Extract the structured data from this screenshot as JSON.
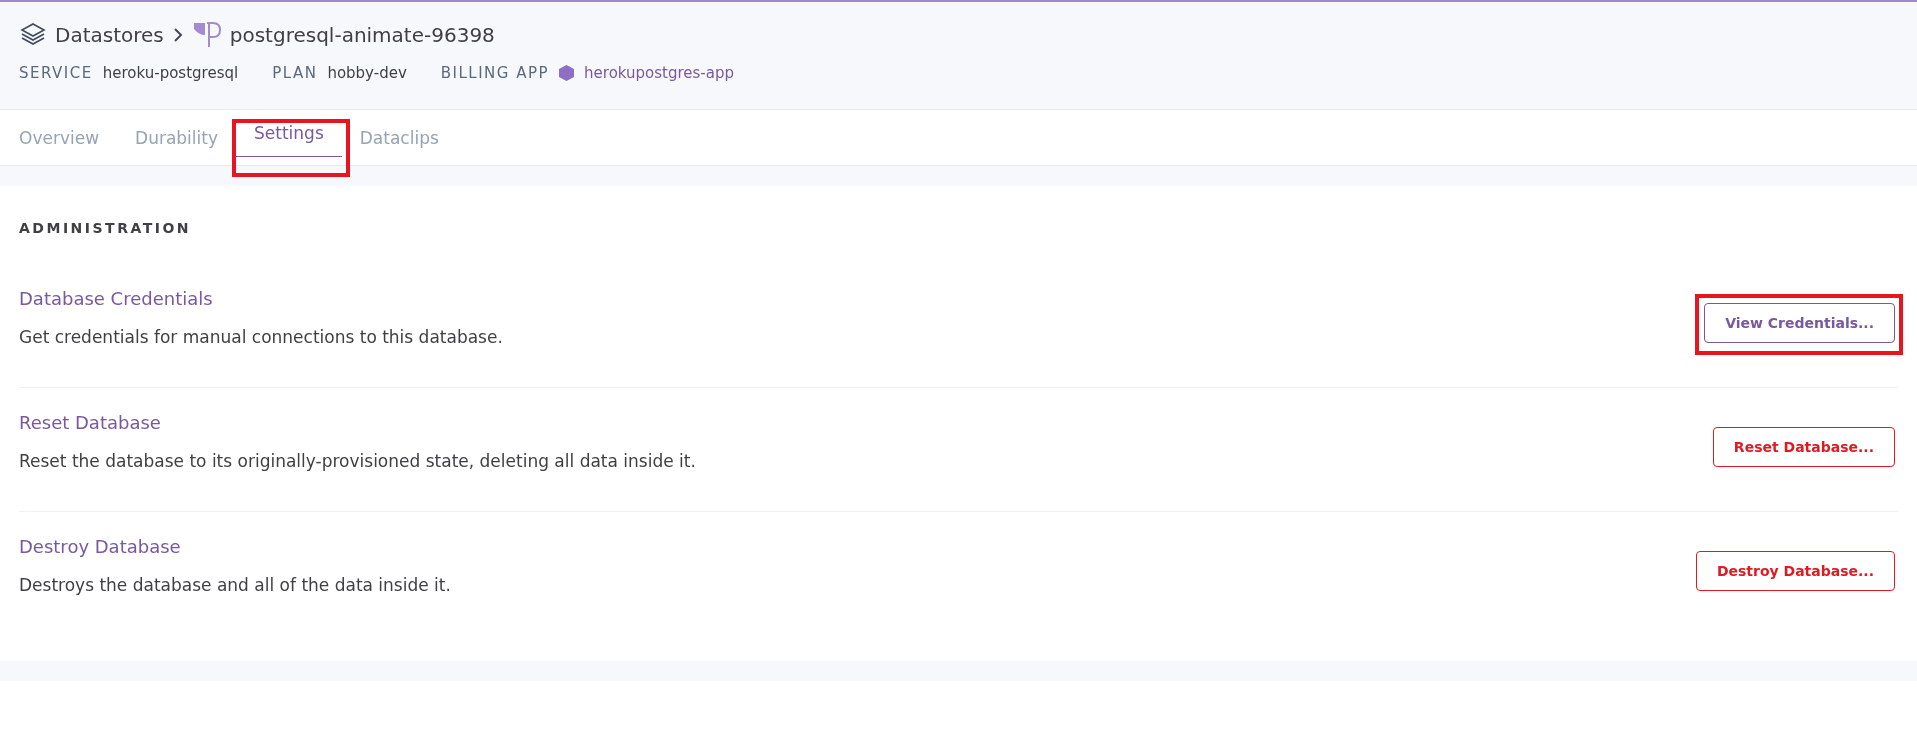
{
  "breadcrumb": {
    "parent": "Datastores",
    "current": "postgresql-animate-96398"
  },
  "meta": [
    {
      "label": "SERVICE",
      "value": "heroku-postgresql",
      "kind": "text"
    },
    {
      "label": "PLAN",
      "value": "hobby-dev",
      "kind": "text"
    },
    {
      "label": "BILLING APP",
      "value": "herokupostgres-app",
      "kind": "app"
    }
  ],
  "tabs": [
    {
      "label": "Overview",
      "selected": false,
      "highlighted": false
    },
    {
      "label": "Durability",
      "selected": false,
      "highlighted": false
    },
    {
      "label": "Settings",
      "selected": true,
      "highlighted": true
    },
    {
      "label": "Dataclips",
      "selected": false,
      "highlighted": false
    }
  ],
  "section": {
    "heading": "ADMINISTRATION",
    "items": [
      {
        "title": "Database Credentials",
        "description": "Get credentials for manual connections to this database.",
        "button": "View Credentials...",
        "kind": "neutral",
        "highlighted": true
      },
      {
        "title": "Reset Database",
        "description": "Reset the database to its originally-provisioned state, deleting all data inside it.",
        "button": "Reset Database...",
        "kind": "danger",
        "highlighted": false
      },
      {
        "title": "Destroy Database",
        "description": "Destroys the database and all of the data inside it.",
        "button": "Destroy Database...",
        "kind": "danger",
        "highlighted": false
      }
    ]
  }
}
